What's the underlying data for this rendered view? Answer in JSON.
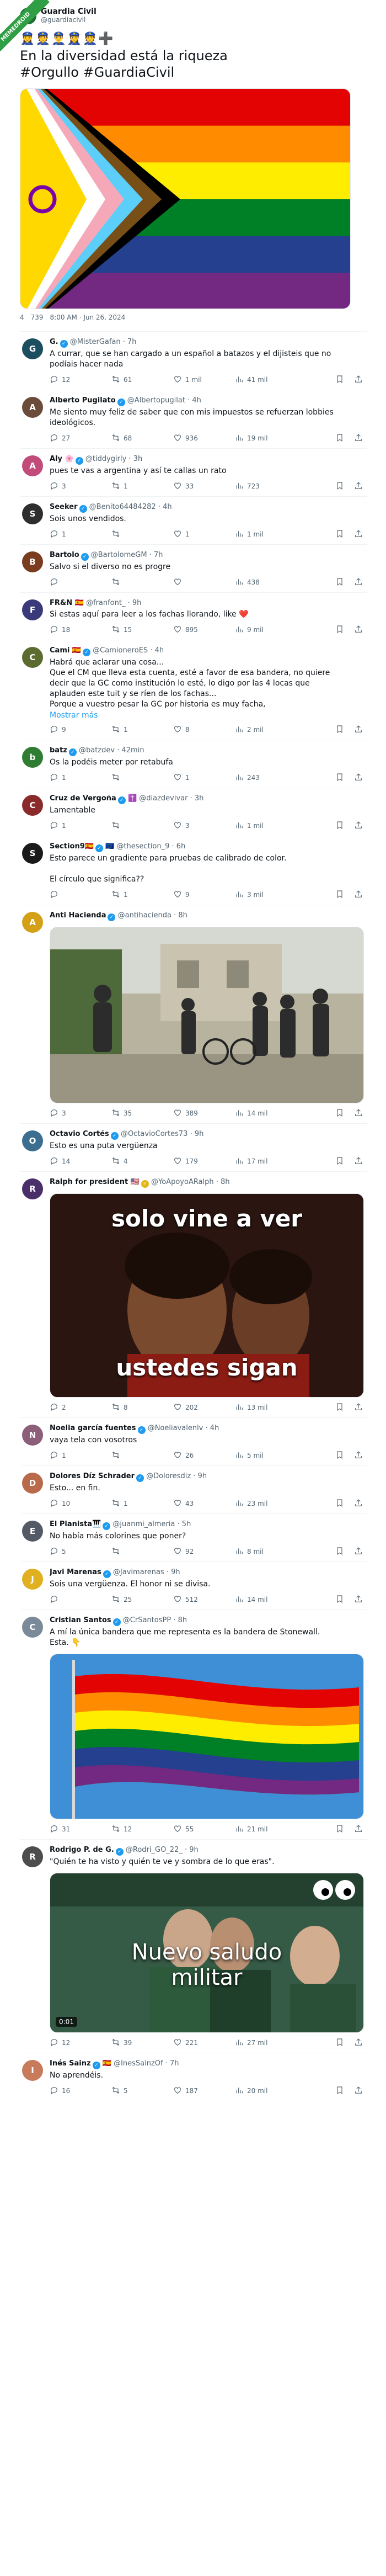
{
  "badge": "MEMEDROID",
  "main": {
    "account_name": "Guardia Civil",
    "handle": "@guardiacivil",
    "emoji_line": "👮‍♀️👮👮‍♂️👮‍♀️👮➕",
    "text_line1": "En la diversidad está la riqueza",
    "text_line2": "#Orgullo #GuardiaCivil",
    "replies": "4",
    "reposts": "739",
    "time": "8:00 AM · Jun 26, 2024",
    "flag_colors": {
      "red": "#e40303",
      "orange": "#ff8c00",
      "yellow": "#ffed00",
      "green": "#008026",
      "blue": "#24408e",
      "violet": "#732982",
      "white": "#ffffff",
      "pink": "#f5a9b8",
      "light_blue": "#5bcefa",
      "brown": "#784f17",
      "black": "#000000",
      "intersex_yellow": "#ffd800",
      "intersex_purple": "#7902aa"
    }
  },
  "replies": [
    {
      "name": "G.",
      "verified": true,
      "handle": "@MisterGafan",
      "time": "7h",
      "text": "A currar, que se han cargado a un español a batazos y el dijisteis que no\npodíais hacer nada",
      "c": "12",
      "r": "61",
      "l": "1 mil",
      "v": "41 mil",
      "color": "#1d4e5f",
      "initial": "G"
    },
    {
      "name": "Alberto Pugilato",
      "verified": true,
      "handle": "@Albertopugilat",
      "time": "4h",
      "text": "Me siento muy feliz de saber que con mis impuestos se refuerzan lobbies\nideológicos.",
      "c": "27",
      "r": "68",
      "l": "936",
      "v": "19 mil",
      "color": "#6b4b3a",
      "initial": "A"
    },
    {
      "name": "Aly 🌸",
      "verified": true,
      "handle": "@tiddygirly",
      "time": "3h",
      "text": "pues te vas a argentina y así te callas un rato",
      "c": "3",
      "r": "1",
      "l": "33",
      "v": "723",
      "color": "#c24b7a",
      "initial": "A"
    },
    {
      "name": "Seeker",
      "verified": true,
      "handle": "@Benito64484282",
      "time": "4h",
      "text": "Sois unos vendidos.",
      "c": "1",
      "r": "",
      "l": "1",
      "v": "1 mil",
      "color": "#2e2e2e",
      "initial": "S"
    },
    {
      "name": "Bartolo",
      "verified": true,
      "handle": "@BartolomeGM",
      "time": "7h",
      "text": "Salvo si el diverso no es progre",
      "c": "",
      "r": "",
      "l": "",
      "v": "438",
      "color": "#7a3b1e",
      "initial": "B"
    },
    {
      "name": "FR&N 🇪🇸",
      "verified": false,
      "handle": "@franfont_",
      "time": "9h",
      "text": "Si estas aquí para leer a los fachas llorando, like ❤️",
      "c": "18",
      "r": "15",
      "l": "895",
      "v": "9 mil",
      "color": "#3a3a7a",
      "initial": "F"
    },
    {
      "name": "Cami 🇪🇸",
      "verified": true,
      "handle": "@CamioneroES",
      "time": "4h",
      "text": "Habrá que aclarar una cosa...\nQue el CM que lleva esta cuenta, esté a favor de esa bandera, no quiere\ndecir que la GC como institución lo esté, lo digo por las 4 locas que\naplauden este tuit y se ríen de los fachas...\nPorque a vuestro pesar la GC por historia es muy facha,",
      "more": "Mostrar más",
      "c": "9",
      "r": "1",
      "l": "8",
      "v": "2 mil",
      "color": "#5c6b2f",
      "initial": "C"
    },
    {
      "name": "batz",
      "verified": true,
      "handle": "@batzdev",
      "time": "42min",
      "text": "Os la podéis meter por retabufa",
      "c": "1",
      "r": "",
      "l": "1",
      "v": "243",
      "color": "#2f7d32",
      "initial": "b"
    },
    {
      "name": "Cruz de Vergoña",
      "verified": true,
      "extra": "✝️",
      "handle": "@diazdevivar",
      "time": "3h",
      "text": "Lamentable",
      "c": "1",
      "r": "",
      "l": "3",
      "v": "1 mil",
      "color": "#8a2b2b",
      "initial": "C"
    },
    {
      "name": "Section9🇪🇸",
      "verified": true,
      "extra": "🇪🇺",
      "handle": "@thesection_9",
      "time": "6h",
      "text": "Esto parece un gradiente para pruebas de calibrado de color.\n\nEl círculo que significa??",
      "c": "",
      "r": "1",
      "l": "9",
      "v": "3 mil",
      "color": "#1a1a1a",
      "initial": "S"
    },
    {
      "name": "Anti Hacienda",
      "verified": true,
      "handle": "@antihacienda",
      "time": "8h",
      "text": "",
      "c": "3",
      "r": "35",
      "l": "389",
      "v": "14 mil",
      "color": "#d4a017",
      "initial": "A",
      "media": "photo"
    },
    {
      "name": "Octavio Cortés",
      "verified": true,
      "handle": "@OctavioCortes73",
      "time": "9h",
      "text": "Esto es una puta vergüenza",
      "c": "14",
      "r": "4",
      "l": "179",
      "v": "17 mil",
      "color": "#3c6e8f",
      "initial": "O"
    },
    {
      "name": "Ralph for president 🇺🇸",
      "verified": true,
      "gold": true,
      "handle": "@YoApoyoARalph",
      "time": "8h",
      "text": "",
      "c": "2",
      "r": "8",
      "l": "202",
      "v": "13 mil",
      "color": "#4a2f6b",
      "initial": "R",
      "media": "gif",
      "gif_top": "solo vine a ver",
      "gif_bottom": "ustedes sigan"
    },
    {
      "name": "Noelia garcía fuentes",
      "verified": true,
      "handle": "@Noeliavalenlv",
      "time": "4h",
      "text": "vaya tela con vosotros",
      "c": "1",
      "r": "",
      "l": "26",
      "v": "5 mil",
      "color": "#8c5e7a",
      "initial": "N"
    },
    {
      "name": "Dolores Díz Schrader",
      "verified": true,
      "handle": "@Doloresdiz",
      "time": "9h",
      "text": "Esto... en fin.",
      "c": "10",
      "r": "1",
      "l": "43",
      "v": "23 mil",
      "color": "#b86a4a",
      "initial": "D"
    },
    {
      "name": "El Pianista🎹",
      "verified": true,
      "handle": "@juanmi_almeria",
      "time": "5h",
      "text": "No había más colorines que poner?",
      "c": "5",
      "r": "",
      "l": "92",
      "v": "8 mil",
      "color": "#555b66",
      "initial": "E"
    },
    {
      "name": "Javi Marenas",
      "verified": true,
      "handle": "@Javimarenas",
      "time": "9h",
      "text": "Sois una vergüenza. El honor ni se divisa.",
      "c": "",
      "r": "25",
      "l": "512",
      "v": "14 mil",
      "color": "#e0b020",
      "initial": "J"
    },
    {
      "name": "Cristian Santos",
      "verified": true,
      "handle": "@CrSantosPP",
      "time": "8h",
      "text": "A mí la única bandera que me representa es la bandera de Stonewall.\nEsta. 👇",
      "c": "31",
      "r": "12",
      "l": "55",
      "v": "21 mil",
      "color": "#7a8a99",
      "initial": "C",
      "media": "rainbow"
    },
    {
      "name": "Rodrigo P. de G.",
      "verified": true,
      "handle": "@Rodri_GO_22_",
      "time": "9h",
      "text": "\"Quién te ha visto y quién te ve y sombra de lo que eras\".",
      "c": "12",
      "r": "39",
      "l": "221",
      "v": "27 mil",
      "color": "#4d4d4d",
      "initial": "R",
      "media": "video",
      "video_caption_1": "Nuevo saludo",
      "video_caption_2": "militar",
      "video_time": "0:01"
    },
    {
      "name": "Inés Sainz",
      "verified": true,
      "extra": "🇪🇸",
      "handle": "@InesSainzOf",
      "time": "7h",
      "text": "No aprendéis.",
      "c": "16",
      "r": "5",
      "l": "187",
      "v": "20 mil",
      "color": "#c77b5a",
      "initial": "I"
    }
  ]
}
